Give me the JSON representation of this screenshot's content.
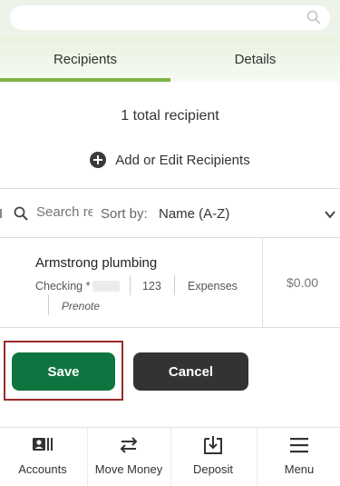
{
  "search": {
    "placeholder": ""
  },
  "tabs": [
    {
      "label": "Recipients",
      "active": true
    },
    {
      "label": "Details",
      "active": false
    }
  ],
  "summary": {
    "total_text": "1 total recipient"
  },
  "add_edit": {
    "label": "Add or Edit Recipients",
    "icon": "plus-circle-icon"
  },
  "filter": {
    "search_placeholder": "Search recipients",
    "sort_label": "Sort by:",
    "sort_value": "Name (A-Z)"
  },
  "recipient": {
    "name": "Armstrong plumbing",
    "account_type": "Checking *",
    "routing_suffix": "123",
    "category": "Expenses",
    "status": "Prenote",
    "amount": "$0.00"
  },
  "actions": {
    "save_label": "Save",
    "cancel_label": "Cancel"
  },
  "nav": {
    "items": [
      {
        "label": "Accounts",
        "icon": "accounts-icon"
      },
      {
        "label": "Move Money",
        "icon": "transfer-arrows-icon"
      },
      {
        "label": "Deposit",
        "icon": "deposit-icon"
      },
      {
        "label": "Menu",
        "icon": "hamburger-menu-icon"
      }
    ]
  },
  "colors": {
    "accent_green": "#7cb342",
    "save_button": "#0f7540",
    "cancel_button": "#333333",
    "highlight_border": "#9a2a2a"
  }
}
